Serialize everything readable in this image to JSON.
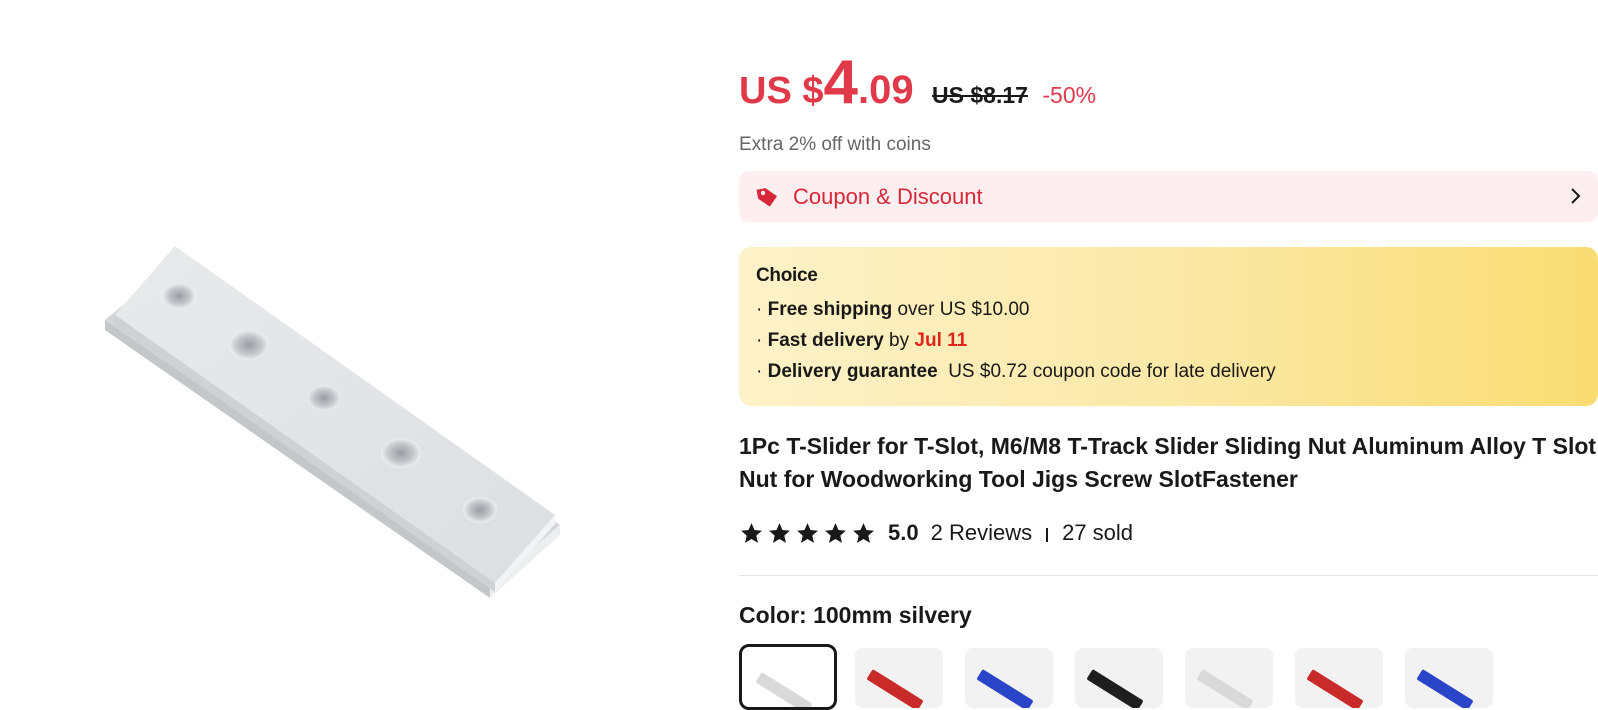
{
  "price": {
    "currency_prefix": "US $",
    "integer": "4",
    "decimal": ".09",
    "original": "US $8.17",
    "discount": "-50%"
  },
  "coins_note": "Extra 2% off with coins",
  "coupon": {
    "label": "Coupon & Discount",
    "icon": "tag-icon"
  },
  "choice": {
    "title": "Choice",
    "lines": [
      {
        "bullet": "· ",
        "bold": "Free shipping",
        "rest": " over US $10.00"
      },
      {
        "bullet": "· ",
        "bold": "Fast delivery",
        "rest": " by ",
        "highlight": "Jul 11"
      },
      {
        "bullet": "· ",
        "bold": "Delivery guarantee",
        "rest": "  US $0.72 coupon code for late delivery"
      }
    ],
    "colors": {
      "gradient_start": "#fdf2c9",
      "gradient_end": "#f9dc72",
      "highlight": "#e0251b"
    }
  },
  "product_title": "1Pc T-Slider for T-Slot, M6/M8 T-Track Slider Sliding Nut Aluminum Alloy T Slot Nut for Woodworking Tool Jigs Screw SlotFastener",
  "rating": {
    "stars": 5,
    "score": "5.0",
    "reviews": "2 Reviews",
    "sold": "27 sold"
  },
  "color_selector": {
    "label": "Color: 100mm silvery",
    "swatches": [
      {
        "color": "#d9d9d9",
        "selected": true
      },
      {
        "color": "#c92a2a",
        "selected": false
      },
      {
        "color": "#2b45c9",
        "selected": false
      },
      {
        "color": "#1e1e1e",
        "selected": false
      },
      {
        "color": "#d9d9d9",
        "selected": false
      },
      {
        "color": "#c92a2a",
        "selected": false
      },
      {
        "color": "#2b45c9",
        "selected": false
      }
    ]
  },
  "colors": {
    "accent": "#e0394a",
    "coupon_bg": "#fdeeef",
    "text": "#191919"
  }
}
